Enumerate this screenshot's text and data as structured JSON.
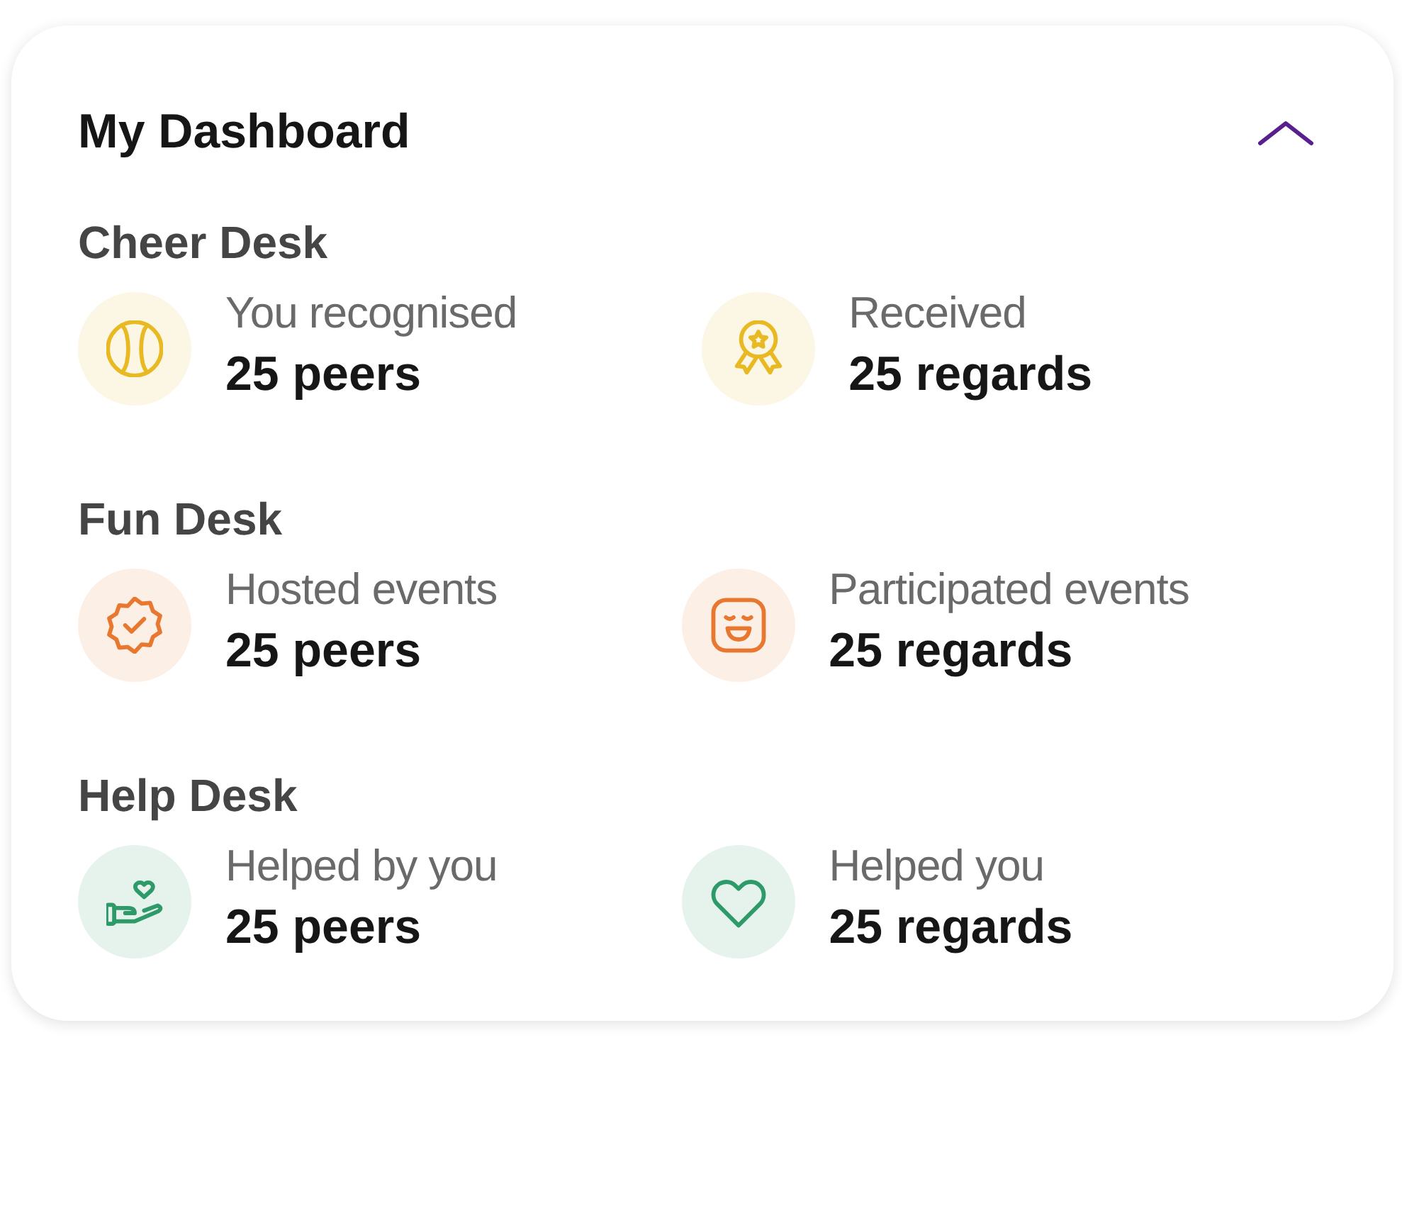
{
  "title": "My Dashboard",
  "expanded": true,
  "sections": [
    {
      "heading": "Cheer Desk",
      "items": [
        {
          "kind": "ball",
          "color": "#e8b923",
          "label": "You recognised",
          "value": "25 peers"
        },
        {
          "kind": "award",
          "color": "#e8b923",
          "label": "Received",
          "value": "25 regards"
        }
      ]
    },
    {
      "heading": "Fun Desk",
      "items": [
        {
          "kind": "badge",
          "color": "#e8782f",
          "label": "Hosted events",
          "value": "25 peers"
        },
        {
          "kind": "smile",
          "color": "#e8782f",
          "label": "Participated events",
          "value": "25 regards"
        }
      ]
    },
    {
      "heading": "Help Desk",
      "items": [
        {
          "kind": "hand",
          "color": "#2e9a6a",
          "label": "Helped by you",
          "value": "25 peers"
        },
        {
          "kind": "heart",
          "color": "#2e9a6a",
          "label": "Helped you",
          "value": "25 regards"
        }
      ]
    }
  ]
}
